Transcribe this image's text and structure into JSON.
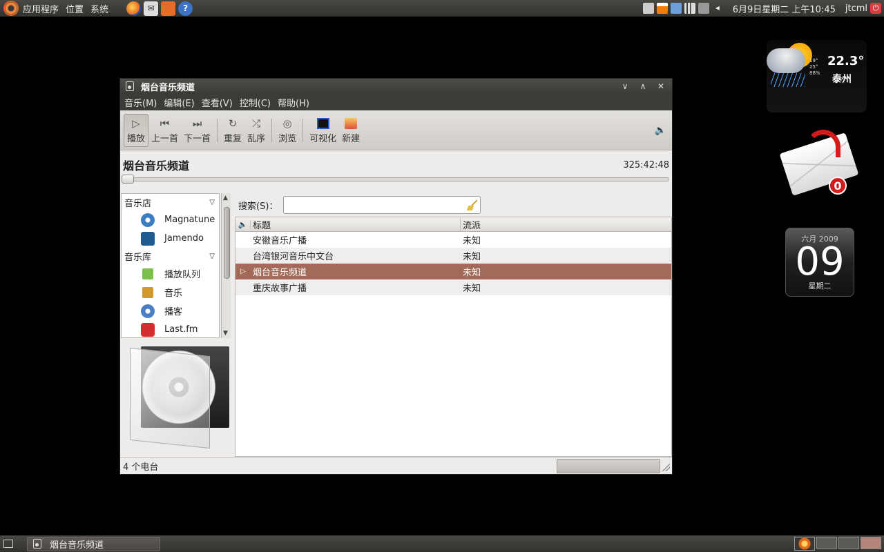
{
  "top_panel": {
    "menus": [
      "应用程序",
      "位置",
      "系统"
    ],
    "clock": "6月9日星期二 上午10:45",
    "user": "jtcml"
  },
  "weather": {
    "temperature": "22.3°",
    "detail": [
      "19°",
      "25°",
      "88%"
    ],
    "city": "泰州"
  },
  "mail_widget": {
    "count": "0"
  },
  "calendar": {
    "month_year": "六月 2009",
    "day": "09",
    "weekday": "星期二"
  },
  "window": {
    "title": "烟台音乐频道",
    "menus": [
      "音乐(M)",
      "编辑(E)",
      "查看(V)",
      "控制(C)",
      "帮助(H)"
    ],
    "toolbar": {
      "play": "播放",
      "previous": "上一首",
      "next": "下一首",
      "repeat": "重复",
      "shuffle": "乱序",
      "browse": "浏览",
      "visualize": "可视化",
      "new": "新建"
    },
    "now_playing": {
      "title": "烟台音乐频道",
      "elapsed": "325:42:48"
    },
    "sidebar": {
      "store_header": "音乐店",
      "store_items": [
        "Magnatune",
        "Jamendo"
      ],
      "library_header": "音乐库",
      "library_items": [
        "播放队列",
        "音乐",
        "播客",
        "Last.fm"
      ]
    },
    "search": {
      "label": "搜索(S)：",
      "value": ""
    },
    "list": {
      "columns": {
        "title": "标题",
        "genre": "流派"
      },
      "rows": [
        {
          "title": "安徽音乐广播",
          "genre": "未知"
        },
        {
          "title": "台湾银河音乐中文台",
          "genre": "未知"
        },
        {
          "title": "烟台音乐频道",
          "genre": "未知"
        },
        {
          "title": "重庆故事广播",
          "genre": "未知"
        }
      ]
    },
    "status": "4 个电台"
  },
  "taskbar": {
    "task_label": "烟台音乐频道"
  }
}
